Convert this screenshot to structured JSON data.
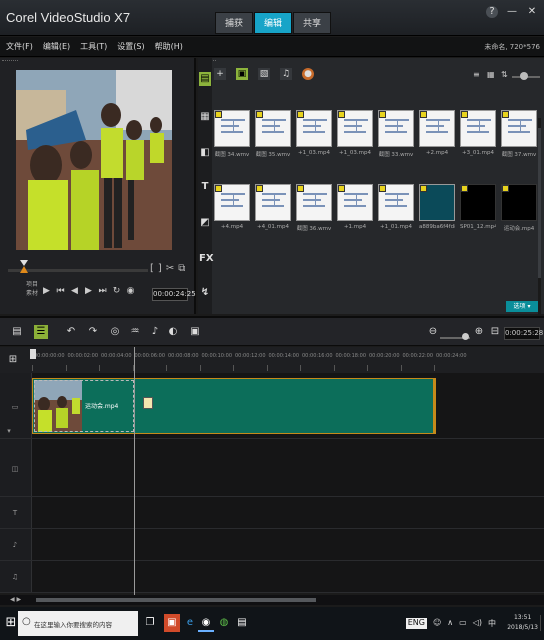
{
  "app": {
    "title": "Corel VideoStudio X7"
  },
  "mode_tabs": [
    {
      "label": "捕获",
      "active": false
    },
    {
      "label": "编辑",
      "active": true
    },
    {
      "label": "共享",
      "active": false
    }
  ],
  "window_controls": {
    "help": "?",
    "minimize": "—",
    "close": "✕"
  },
  "menu": {
    "items": [
      "文件(F)",
      "编辑(E)",
      "工具(T)",
      "设置(S)",
      "帮助(H)"
    ],
    "project_info": "未命名, 720*576"
  },
  "player": {
    "mode_labels": [
      "项目",
      "素材"
    ],
    "timecode": "00:00:24:25",
    "controls": [
      "play-icon",
      "to-start-icon",
      "prev-frame-icon",
      "next-frame-icon",
      "to-end-icon",
      "repeat-icon",
      "volume-icon"
    ],
    "mark_icons": [
      "[",
      "]",
      "✂",
      "⧉"
    ]
  },
  "library": {
    "side_icons": [
      "media",
      "instant-project",
      "transition",
      "title",
      "graphic",
      "fx",
      "path"
    ],
    "toolbar": [
      "add-icon",
      "video-filter",
      "image-filter",
      "audio-filter",
      "more"
    ],
    "options_label": "选项 ▾",
    "thumbnails": [
      {
        "label": "截图 34.wmv",
        "kind": "doc"
      },
      {
        "label": "截图 35.wmv",
        "kind": "doc"
      },
      {
        "label": "+1_03.mp4",
        "kind": "doc"
      },
      {
        "label": "+1_03.mp4",
        "kind": "doc"
      },
      {
        "label": "截图 33.wmv",
        "kind": "doc"
      },
      {
        "label": "+2.mp4",
        "kind": "doc"
      },
      {
        "label": "+3_01.mp4",
        "kind": "doc"
      },
      {
        "label": "截图 37.wmv",
        "kind": "doc"
      },
      {
        "label": "+4.mp4",
        "kind": "doc"
      },
      {
        "label": "+4_01.mp4",
        "kind": "doc"
      },
      {
        "label": "截图 36.wmv",
        "kind": "doc"
      },
      {
        "label": "+1.mp4",
        "kind": "doc"
      },
      {
        "label": "+1_01.mp4",
        "kind": "doc"
      },
      {
        "label": "a889ba6f4fd8c9",
        "kind": "phone"
      },
      {
        "label": "SP01_12.mp4",
        "kind": "dark"
      },
      {
        "label": "运动会.mp4",
        "kind": "dark"
      }
    ]
  },
  "timeline": {
    "duration": "0:00:25:28",
    "ruler_labels": [
      "00:00:00:00",
      "00:00:02:00",
      "00:00:04:00",
      "00:00:06:00",
      "00:00:08:00",
      "00:00:10:00",
      "00:00:12:00",
      "00:00:14:00",
      "00:00:16:00",
      "00:00:18:00",
      "00:00:20:00",
      "00:00:22:00",
      "00:00:24:00"
    ],
    "clip": {
      "name": "运动会.mp4"
    },
    "track_icons": [
      "video-track-icon",
      "overlay-track-icon",
      "title-track-icon",
      "voice-track-icon",
      "music-track-icon"
    ]
  },
  "taskbar": {
    "search_placeholder": "在这里输入你要搜索的内容",
    "language": "ENG",
    "time": "13:51",
    "date": "2018/5/13"
  },
  "colors": {
    "accent": "#17a4c8",
    "clip": "#0c6e5a",
    "clip_border": "#c58a1b",
    "active_tool": "#8cb038"
  }
}
